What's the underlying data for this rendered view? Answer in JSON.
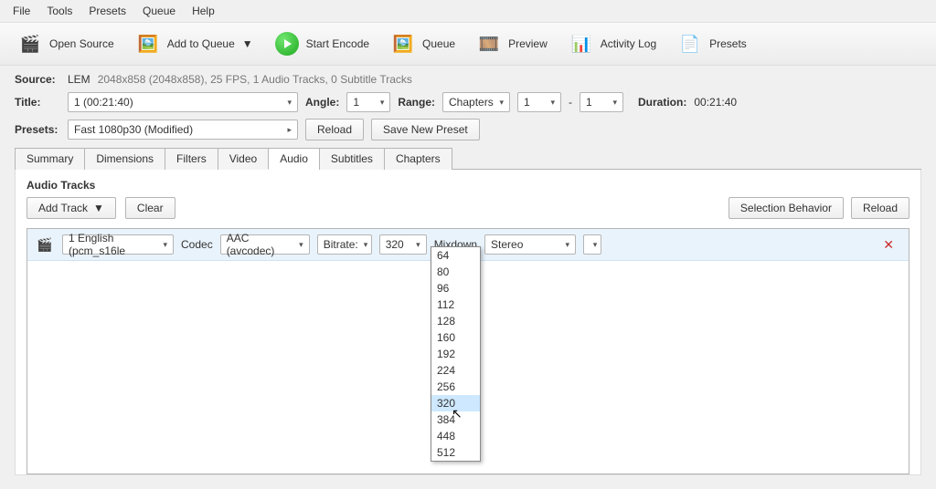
{
  "menu": [
    "File",
    "Tools",
    "Presets",
    "Queue",
    "Help"
  ],
  "toolbar": {
    "open_source": "Open Source",
    "add_to_queue": "Add to Queue",
    "start_encode": "Start Encode",
    "queue": "Queue",
    "preview": "Preview",
    "activity_log": "Activity Log",
    "presets": "Presets"
  },
  "source": {
    "label": "Source:",
    "name": "LEM",
    "info": "2048x858 (2048x858), 25 FPS, 1 Audio Tracks, 0 Subtitle Tracks"
  },
  "title_row": {
    "label": "Title:",
    "value": "1 (00:21:40)",
    "angle_label": "Angle:",
    "angle": "1",
    "range_label": "Range:",
    "range_type": "Chapters",
    "range_from": "1",
    "range_dash": "-",
    "range_to": "1",
    "duration_label": "Duration:",
    "duration": "00:21:40"
  },
  "preset_row": {
    "label": "Presets:",
    "value": "Fast 1080p30  (Modified)",
    "reload": "Reload",
    "save_new": "Save New Preset"
  },
  "tabs": [
    "Summary",
    "Dimensions",
    "Filters",
    "Video",
    "Audio",
    "Subtitles",
    "Chapters"
  ],
  "active_tab": "Audio",
  "audio_panel": {
    "header": "Audio Tracks",
    "add_track": "Add Track",
    "clear": "Clear",
    "selection_behavior": "Selection Behavior",
    "reload": "Reload"
  },
  "track": {
    "source": "1 English (pcm_s16le",
    "codec_label": "Codec",
    "codec": "AAC (avcodec)",
    "bitrate_label": "Bitrate:",
    "bitrate": "320",
    "mixdown_label": "Mixdown",
    "mixdown": "Stereo"
  },
  "bitrate_options": [
    "64",
    "80",
    "96",
    "112",
    "128",
    "160",
    "192",
    "224",
    "256",
    "320",
    "384",
    "448",
    "512"
  ],
  "bitrate_selected": "320"
}
